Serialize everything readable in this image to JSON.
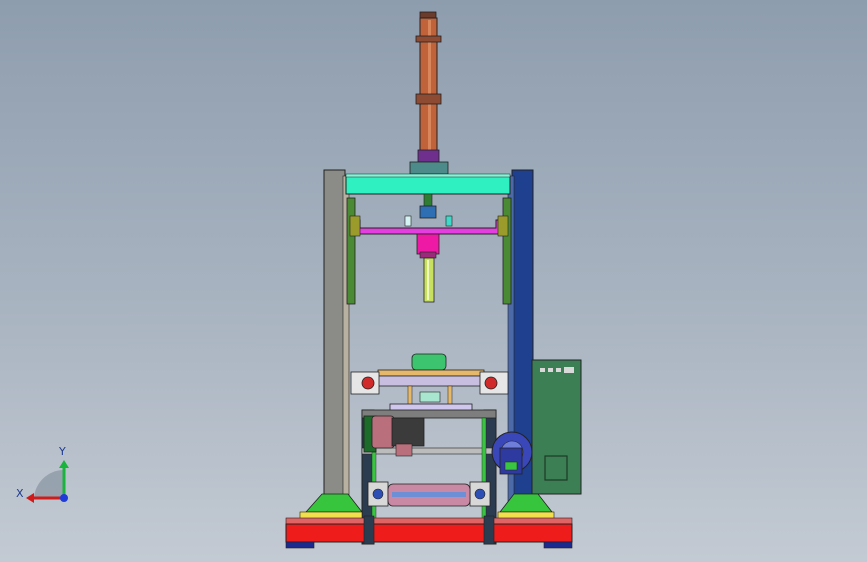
{
  "viewport": {
    "background_top": "#8e9dae",
    "background_bottom": "#c3cad3"
  },
  "triad": {
    "x_label": "X",
    "y_label": "Y",
    "x_color": "#d11a1a",
    "y_color": "#19b43c",
    "z_color": "#1f3bd9"
  },
  "machine": {
    "cylinder_color": "#c0633b",
    "frame_left_color": "#8b8b87",
    "frame_right_color": "#1f3f8f",
    "top_beam_color": "#2ff0c0",
    "press_plate_color": "#e43de0",
    "base_color": "#ef1c1c",
    "motor_color": "#b9707c",
    "control_box_color": "#3c7f55",
    "foot_color": "#36c53c"
  }
}
